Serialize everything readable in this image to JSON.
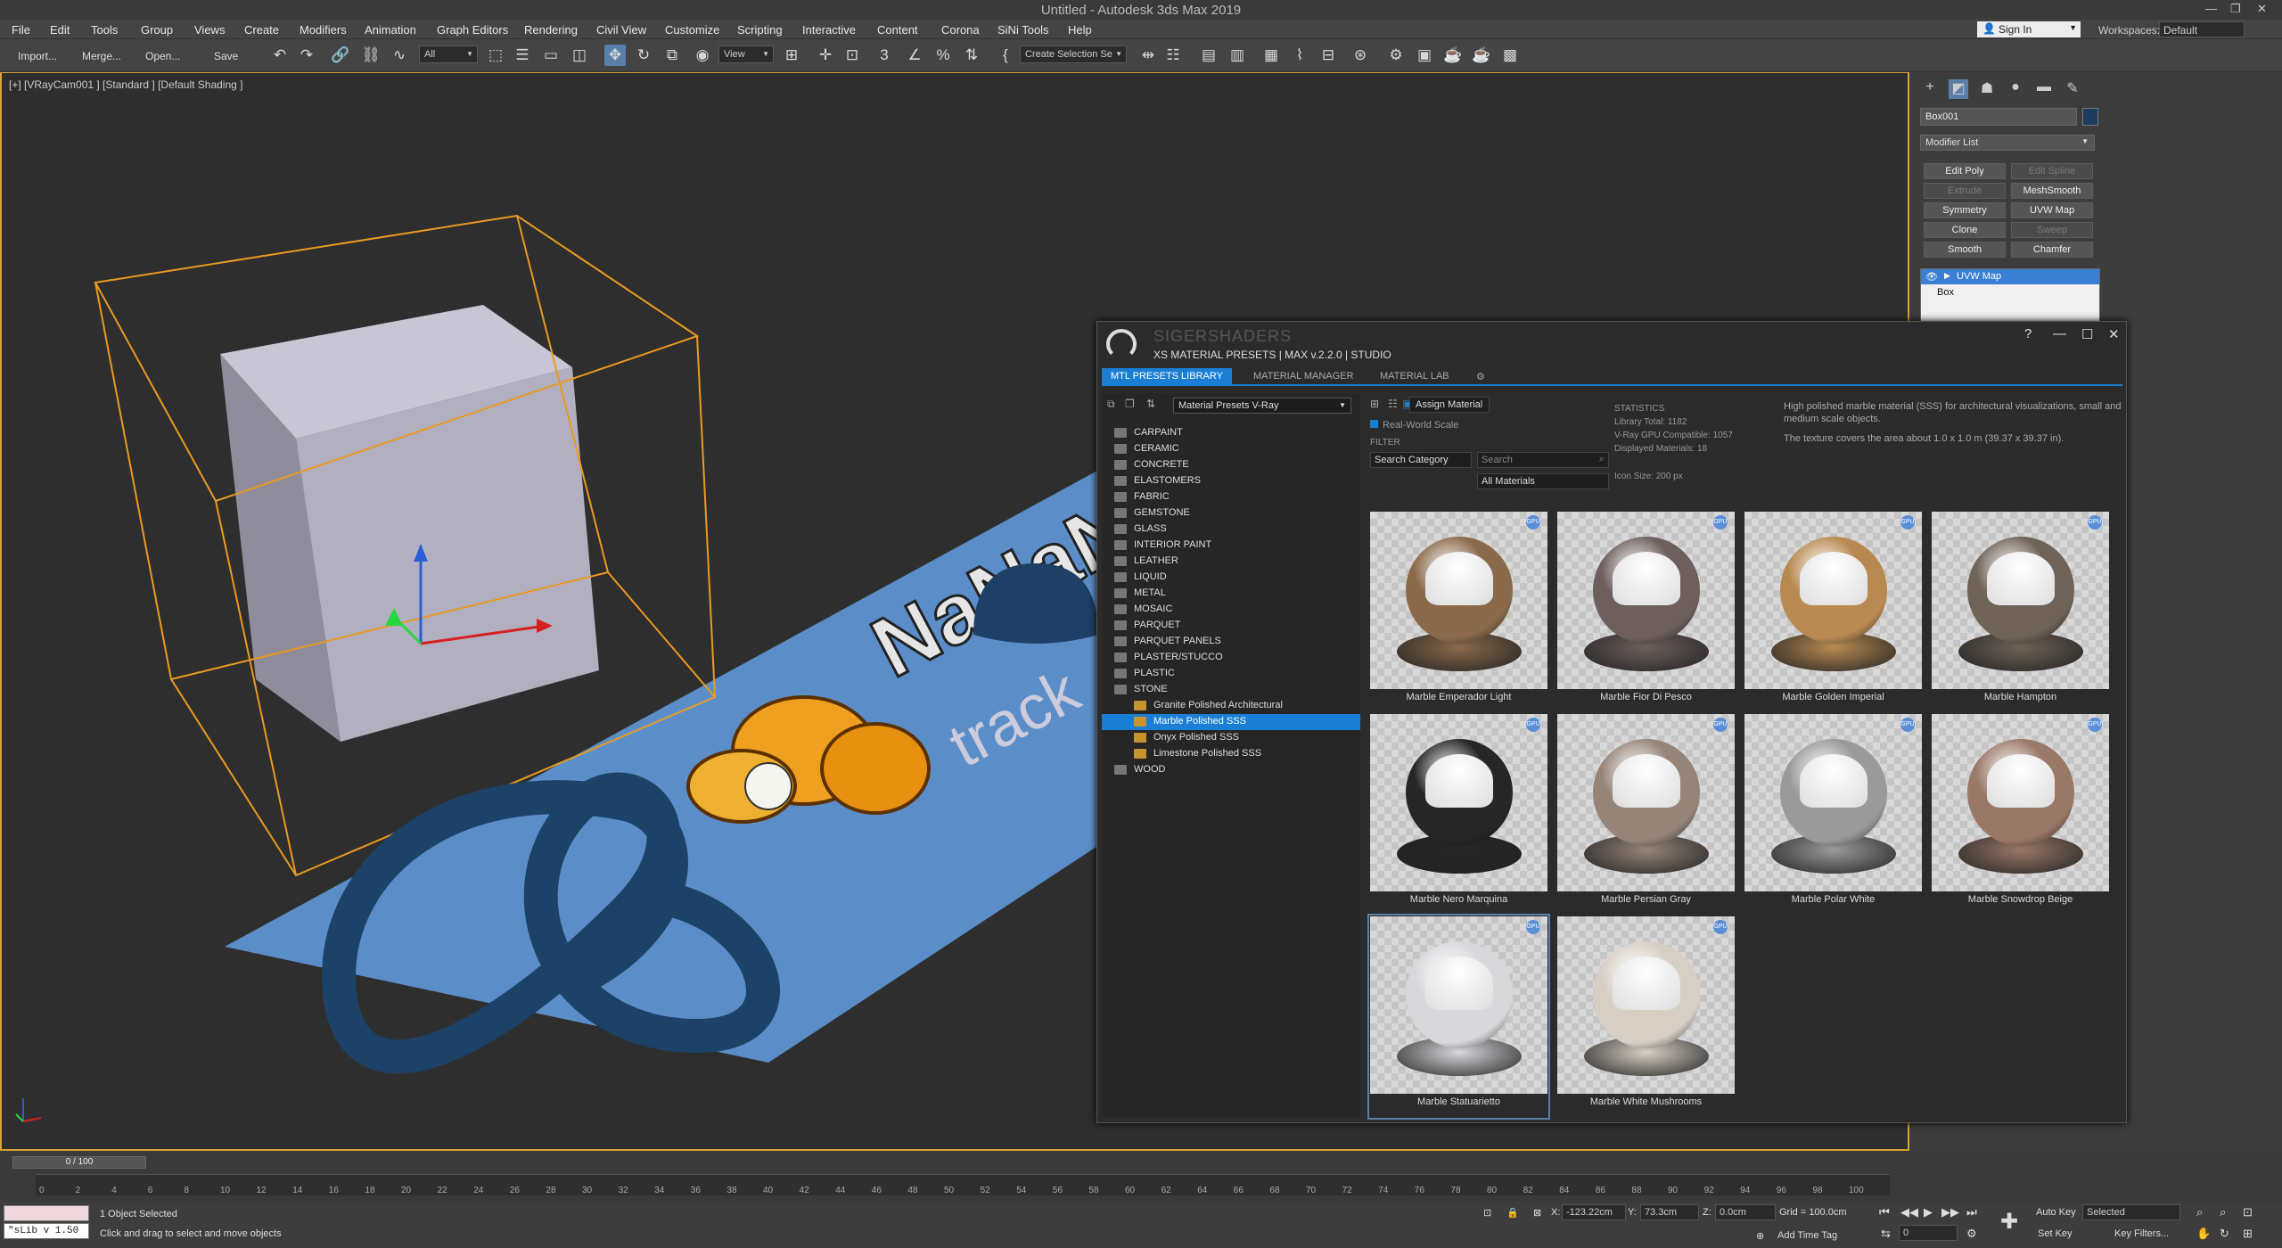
{
  "app": {
    "title": "Untitled - Autodesk 3ds Max 2019"
  },
  "menu": [
    "File",
    "Edit",
    "Tools",
    "Group",
    "Views",
    "Create",
    "Modifiers",
    "Animation",
    "Graph Editors",
    "Rendering",
    "Civil View",
    "Customize",
    "Scripting",
    "Interactive",
    "Content",
    "Corona",
    "SiNi Tools",
    "Help"
  ],
  "account": {
    "sign_in": "Sign In",
    "workspaces_label": "Workspaces:",
    "workspace": "Default"
  },
  "toolbar": {
    "import": "Import...",
    "merge": "Merge...",
    "open": "Open...",
    "save": "Save",
    "filter": "All",
    "ref_coord": "View",
    "selection_set": "Create Selection Se"
  },
  "viewport": {
    "label": "[+] [VRayCam001 ] [Standard ] [Default Shading ]"
  },
  "command_panel": {
    "object_name": "Box001",
    "modifier_list": "Modifier List",
    "buttons": [
      {
        "label": "Edit Poly",
        "enabled": true
      },
      {
        "label": "Edit Spline",
        "enabled": false
      },
      {
        "label": "Extrude",
        "enabled": false
      },
      {
        "label": "MeshSmooth",
        "enabled": true
      },
      {
        "label": "Symmetry",
        "enabled": true
      },
      {
        "label": "UVW Map",
        "enabled": true
      },
      {
        "label": "Clone",
        "enabled": true
      },
      {
        "label": "Sweep",
        "enabled": false
      },
      {
        "label": "Smooth",
        "enabled": true
      },
      {
        "label": "Chamfer",
        "enabled": true
      }
    ],
    "stack": [
      "UVW Map",
      "Box"
    ]
  },
  "mtl": {
    "brand": "SIGERSHADERS",
    "subtitle": "XS MATERIAL PRESETS | MAX v.2.2.0 | STUDIO",
    "window_buttons": [
      "?",
      "—",
      "☐",
      "✕"
    ],
    "tabs": [
      "MTL PRESETS LIBRARY",
      "MATERIAL MANAGER",
      "MATERIAL LAB"
    ],
    "library": "Material Presets V-Ray",
    "assign": "Assign Material",
    "real_world": "Real-World Scale",
    "filter_label": "FILTER",
    "search_category": "Search Category",
    "search_placeholder": "Search",
    "all_materials": "All Materials",
    "stats": {
      "heading": "STATISTICS",
      "total": "Library Total: 1182",
      "gpu": "V-Ray GPU Compatible: 1057",
      "displayed": "Displayed Materials: 18"
    },
    "icon_size": "Icon Size: 200 px",
    "description": "High polished marble material (SSS) for architectural visualizations, small and medium scale objects.",
    "description2": "The texture covers the area about 1.0 x 1.0 m (39.37 x 39.37 in).",
    "tree": [
      {
        "label": "CARPAINT",
        "child": false
      },
      {
        "label": "CERAMIC",
        "child": false
      },
      {
        "label": "CONCRETE",
        "child": false
      },
      {
        "label": "ELASTOMERS",
        "child": false
      },
      {
        "label": "FABRIC",
        "child": false
      },
      {
        "label": "GEMSTONE",
        "child": false
      },
      {
        "label": "GLASS",
        "child": false
      },
      {
        "label": "INTERIOR PAINT",
        "child": false
      },
      {
        "label": "LEATHER",
        "child": false
      },
      {
        "label": "LIQUID",
        "child": false
      },
      {
        "label": "METAL",
        "child": false
      },
      {
        "label": "MOSAIC",
        "child": false
      },
      {
        "label": "PARQUET",
        "child": false
      },
      {
        "label": "PARQUET PANELS",
        "child": false
      },
      {
        "label": "PLASTER/STUCCO",
        "child": false
      },
      {
        "label": "PLASTIC",
        "child": false
      },
      {
        "label": "STONE",
        "child": false
      },
      {
        "label": "Granite Polished Architectural",
        "child": true
      },
      {
        "label": "Marble Polished SSS",
        "child": true,
        "selected": true
      },
      {
        "label": "Onyx Polished SSS",
        "child": true
      },
      {
        "label": "Limestone Polished SSS",
        "child": true
      },
      {
        "label": "WOOD",
        "child": false
      }
    ],
    "materials": [
      {
        "name": "Marble Emperador Light",
        "color": "#8a6a4a"
      },
      {
        "name": "Marble Fior Di Pesco",
        "color": "#6e5f5c"
      },
      {
        "name": "Marble Golden Imperial",
        "color": "#b88a52"
      },
      {
        "name": "Marble Hampton",
        "color": "#6f6256"
      },
      {
        "name": "Marble Nero Marquina",
        "color": "#262626"
      },
      {
        "name": "Marble Persian Gray",
        "color": "#968478"
      },
      {
        "name": "Marble Polar White",
        "color": "#9a9a9a"
      },
      {
        "name": "Marble Snowdrop Beige",
        "color": "#9a7868"
      },
      {
        "name": "Marble Statuarietto",
        "color": "#d8d8dc",
        "selected": true
      },
      {
        "name": "Marble White Mushrooms",
        "color": "#d8cfc4"
      }
    ]
  },
  "timeline": {
    "frame": "0 / 100",
    "ticks": [
      "0",
      "2",
      "4",
      "6",
      "8",
      "10",
      "12",
      "14",
      "16",
      "18",
      "20",
      "22",
      "24",
      "26",
      "28",
      "30",
      "32",
      "34",
      "36",
      "38",
      "40",
      "42",
      "44",
      "46",
      "48",
      "50",
      "52",
      "54",
      "56",
      "58",
      "60",
      "62",
      "64",
      "66",
      "68",
      "70",
      "72",
      "74",
      "76",
      "78",
      "80",
      "82",
      "84",
      "86",
      "88",
      "90",
      "92",
      "94",
      "96",
      "98",
      "100"
    ]
  },
  "status": {
    "maxscript": "\"sLib v 1.50",
    "selected": "1 Object Selected",
    "prompt": "Click and drag to select and move objects",
    "x_label": "X:",
    "x": "-123.22cm",
    "y_label": "Y:",
    "y": "73.3cm",
    "z_label": "Z:",
    "z": "0.0cm",
    "grid": "Grid = 100.0cm",
    "add_time_tag": "Add Time Tag",
    "auto_key": "Auto Key",
    "set_key": "Set Key",
    "selected_drop": "Selected",
    "key_filters": "Key Filters...",
    "frame": "0"
  }
}
